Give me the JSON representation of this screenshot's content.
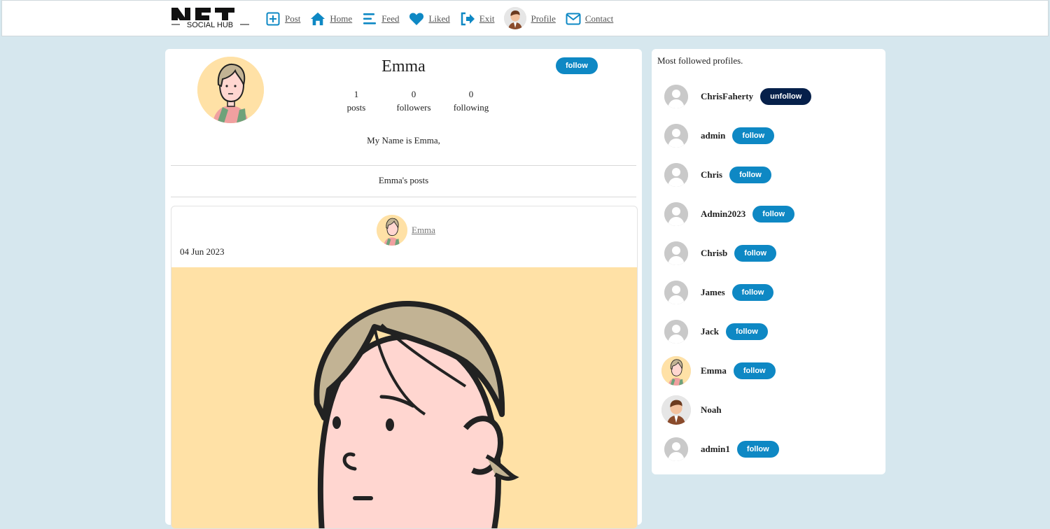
{
  "logo": {
    "text_top": "NFT",
    "text_bottom": "SOCIAL HUB"
  },
  "nav": {
    "post": "Post",
    "home": "Home",
    "feed": "Feed",
    "liked": "Liked",
    "exit": "Exit",
    "profile": "Profile",
    "contact": "Contact"
  },
  "profile": {
    "name": "Emma",
    "follow_label": "follow",
    "stats": [
      {
        "value": "1",
        "label": "posts"
      },
      {
        "value": "0",
        "label": "followers"
      },
      {
        "value": "0",
        "label": "following"
      }
    ],
    "bio": "My Name is Emma,",
    "posts_heading": "Emma's posts"
  },
  "post": {
    "author": "Emma",
    "date": "04 Jun 2023"
  },
  "sidebar": {
    "title": "Most followed profiles.",
    "profiles": [
      {
        "name": "ChrisFaherty",
        "button": "unfollow"
      },
      {
        "name": "admin",
        "button": "follow"
      },
      {
        "name": "Chris",
        "button": "follow"
      },
      {
        "name": "Admin2023",
        "button": "follow"
      },
      {
        "name": "Chrisb",
        "button": "follow"
      },
      {
        "name": "James",
        "button": "follow"
      },
      {
        "name": "Jack",
        "button": "follow"
      },
      {
        "name": "Emma",
        "button": "follow"
      },
      {
        "name": "Noah",
        "button": ""
      },
      {
        "name": "admin1",
        "button": "follow"
      }
    ]
  },
  "colors": {
    "background": "#d6e7ee",
    "accent": "#0e88c4",
    "unfollow": "#06204a"
  }
}
